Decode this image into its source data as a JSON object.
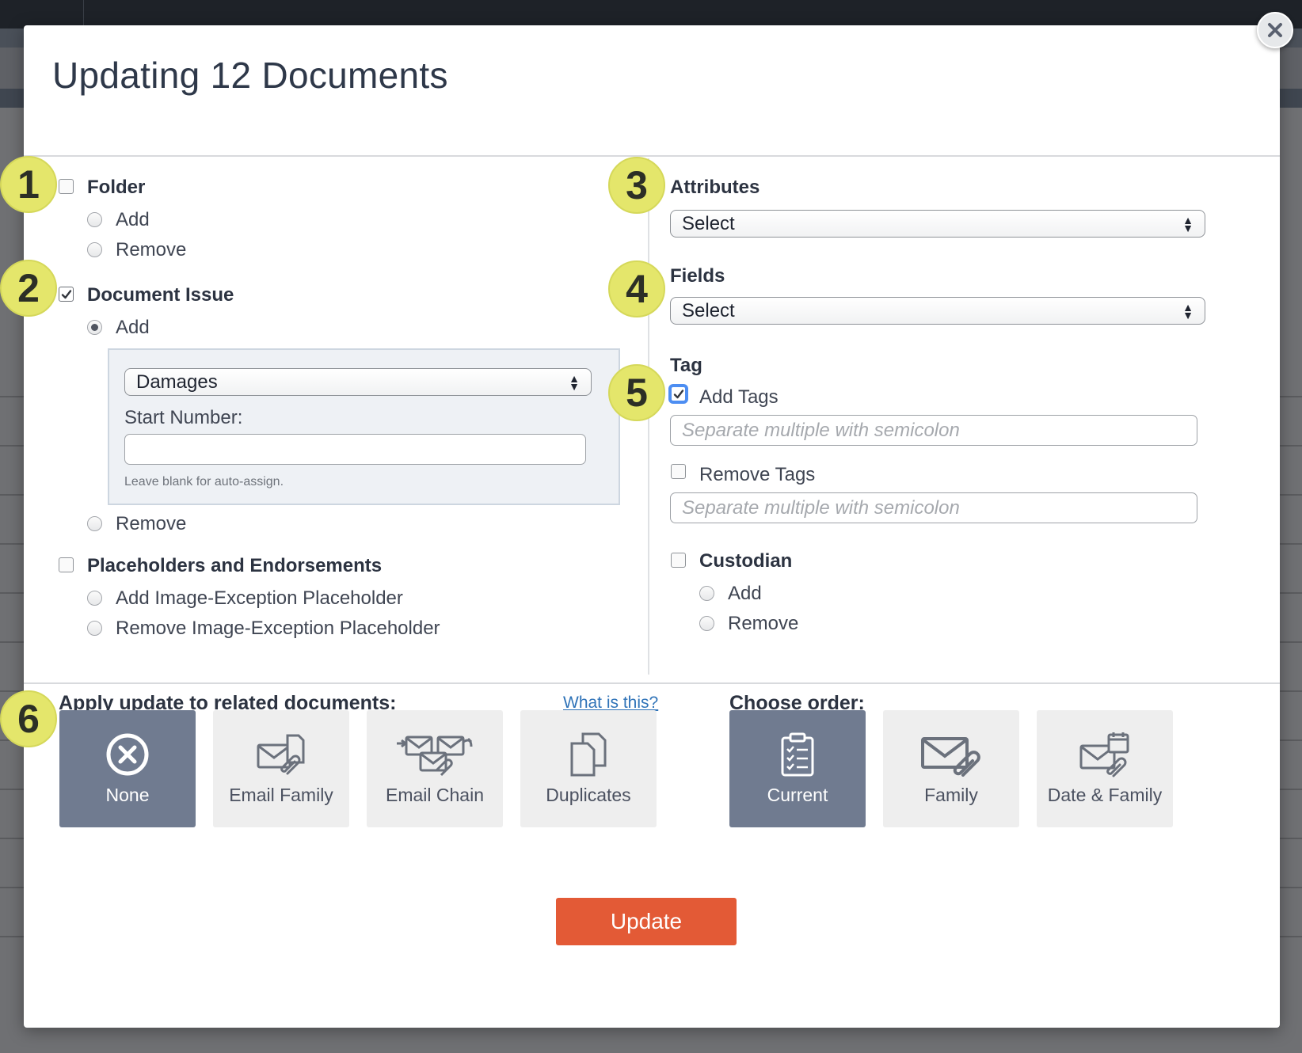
{
  "modal": {
    "title": "Updating 12 Documents",
    "close_icon": "close-icon"
  },
  "left": {
    "folder": {
      "label": "Folder",
      "checked": false,
      "add_label": "Add",
      "remove_label": "Remove"
    },
    "document_issue": {
      "label": "Document Issue",
      "checked": true,
      "add_label": "Add",
      "add_selected": true,
      "issue_select_value": "Damages",
      "start_number_label": "Start Number:",
      "start_number_value": "",
      "help_text": "Leave blank for auto-assign.",
      "remove_label": "Remove"
    },
    "placeholders": {
      "label": "Placeholders and Endorsements",
      "checked": false,
      "add_label": "Add Image-Exception Placeholder",
      "remove_label": "Remove Image-Exception Placeholder"
    }
  },
  "right": {
    "attributes": {
      "label": "Attributes",
      "select_value": "Select"
    },
    "fields": {
      "label": "Fields",
      "select_value": "Select"
    },
    "tag": {
      "label": "Tag",
      "add_tags_label": "Add Tags",
      "add_tags_checked": true,
      "add_tags_placeholder": "Separate multiple with semicolon",
      "remove_tags_label": "Remove Tags",
      "remove_tags_checked": false,
      "remove_tags_placeholder": "Separate multiple with semicolon"
    },
    "custodian": {
      "label": "Custodian",
      "checked": false,
      "add_label": "Add",
      "remove_label": "Remove"
    }
  },
  "related": {
    "label": "Apply update to related documents:",
    "help_link": "What is this?",
    "options": [
      {
        "label": "None",
        "icon": "none-icon",
        "active": true
      },
      {
        "label": "Email Family",
        "icon": "email-family-icon",
        "active": false
      },
      {
        "label": "Email Chain",
        "icon": "email-chain-icon",
        "active": false
      },
      {
        "label": "Duplicates",
        "icon": "duplicates-icon",
        "active": false
      }
    ]
  },
  "order": {
    "label": "Choose order:",
    "options": [
      {
        "label": "Current",
        "icon": "clipboard-icon",
        "active": true
      },
      {
        "label": "Family",
        "icon": "family-icon",
        "active": false
      },
      {
        "label": "Date & Family",
        "icon": "date-family-icon",
        "active": false
      }
    ]
  },
  "annotations": [
    "1",
    "2",
    "3",
    "4",
    "5",
    "6"
  ],
  "update_button": "Update",
  "colors": {
    "accent_button": "#e35a36",
    "active_tile": "#707b90",
    "inactive_tile": "#eeeeee",
    "badge": "#e4e66b",
    "link": "#2f73b8"
  }
}
